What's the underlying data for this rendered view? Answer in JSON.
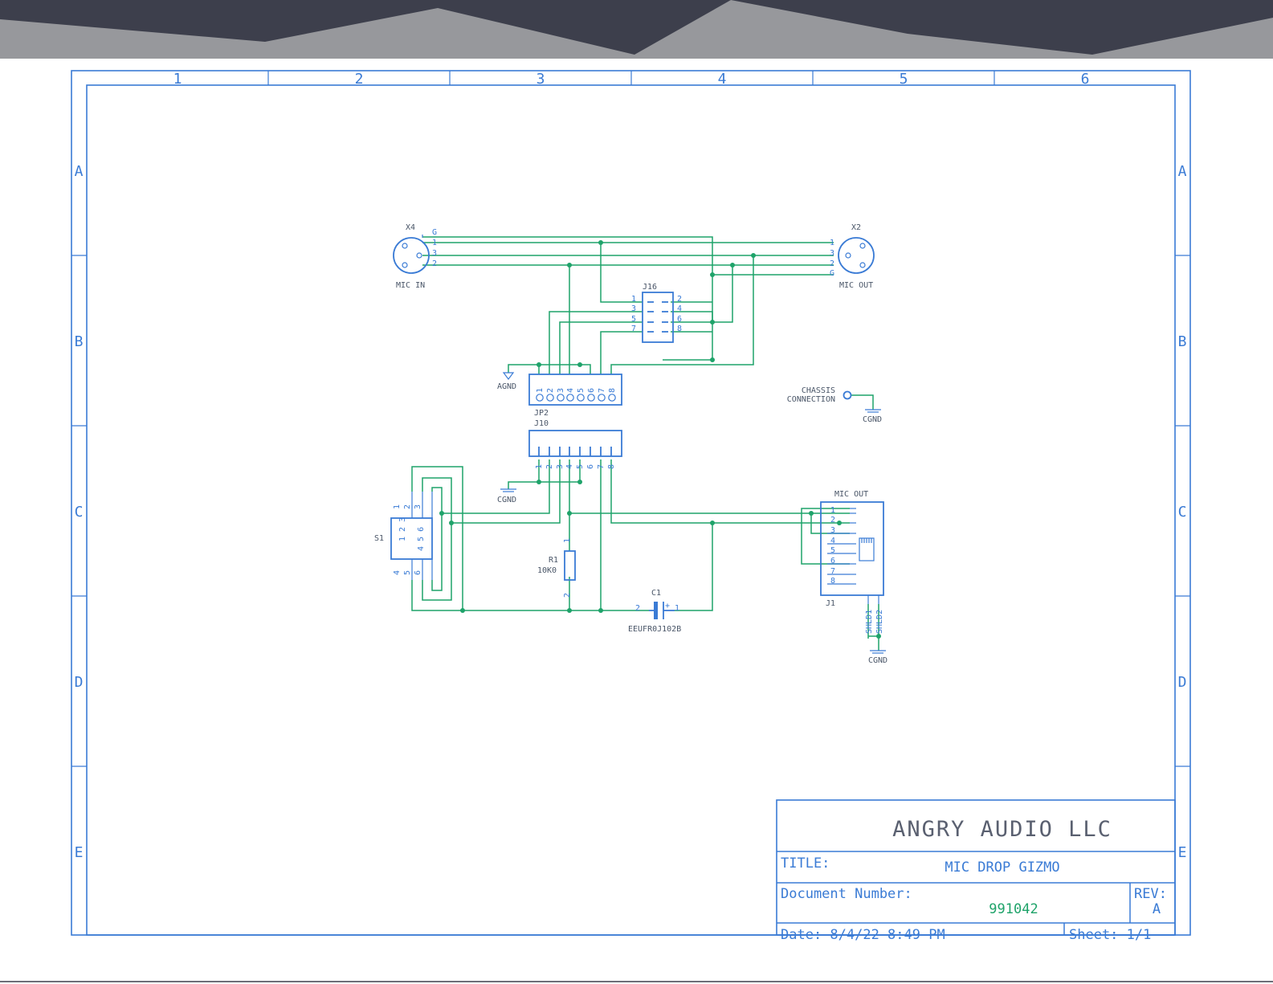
{
  "columns": [
    "1",
    "2",
    "3",
    "4",
    "5",
    "6"
  ],
  "rows": [
    "A",
    "B",
    "C",
    "D",
    "E"
  ],
  "components": {
    "x4": {
      "ref": "X4",
      "name": "MIC IN",
      "pins": [
        "G",
        "1",
        "3",
        "2"
      ]
    },
    "x2": {
      "ref": "X2",
      "name": "MIC OUT",
      "pins": [
        "1",
        "3",
        "2",
        "G"
      ]
    },
    "j16": {
      "ref": "J16",
      "pins_left": [
        "1",
        "3",
        "5",
        "7"
      ],
      "pins_right": [
        "2",
        "4",
        "6",
        "8"
      ]
    },
    "jp2": {
      "ref": "JP2",
      "pins": [
        "1",
        "2",
        "3",
        "4",
        "5",
        "6",
        "7",
        "8"
      ]
    },
    "j10": {
      "ref": "J10",
      "pins": [
        "1",
        "2",
        "3",
        "4",
        "5",
        "6",
        "7",
        "8"
      ]
    },
    "s1": {
      "ref": "S1",
      "top_pins": [
        "1",
        "2",
        "3"
      ],
      "bottom_pins": [
        "4",
        "5",
        "6"
      ],
      "body_top": "1 2 3",
      "body_bottom": "4 5 6"
    },
    "r1": {
      "ref": "R1",
      "value": "10K0",
      "pin1": "1",
      "pin2": "2"
    },
    "c1": {
      "ref": "C1",
      "part": "EEUFR0J102B",
      "pin_neg": "2",
      "pin_pos": "1",
      "plus": "+"
    },
    "j1": {
      "ref": "J1",
      "name": "MIC OUT",
      "pins": [
        "1",
        "2",
        "3",
        "4",
        "5",
        "6",
        "7",
        "8"
      ],
      "shield1": "SHLD1",
      "shield2": "SHLD2"
    },
    "chassis": {
      "line1": "CHASSIS",
      "line2": "CONNECTION"
    },
    "supplies": {
      "agnd": "AGND",
      "cgnd": "CGND"
    }
  },
  "title_block": {
    "company": "ANGRY AUDIO LLC",
    "title_label": "TITLE:",
    "title_value": "MIC DROP GIZMO",
    "docnum_label": "Document Number:",
    "docnum_value": "991042",
    "rev_label": "REV:",
    "rev_value": "A",
    "date_text": "Date: 8/4/22 8:49 PM",
    "sheet_text": "Sheet: 1/1"
  },
  "colors": {
    "header_dark": "#3d3f4c",
    "header_gray": "#97989c",
    "frame": "#3a7bd5",
    "wire": "#1fa36a"
  }
}
